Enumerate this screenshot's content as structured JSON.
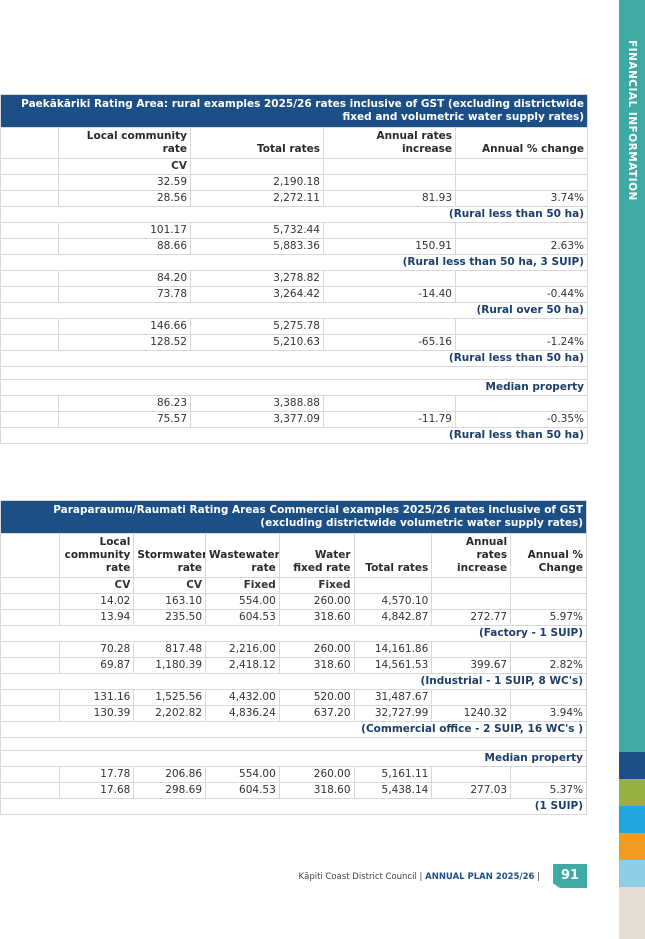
{
  "side": {
    "label": "FINANCIAL INFORMATION"
  },
  "table1": {
    "title": "Paekākāriki Rating Area: rural examples 2025/26 rates inclusive of GST (excluding districtwide fixed and volumetric water supply rates)",
    "headers": [
      "",
      "Local community rate",
      "Total rates",
      "Annual rates increase",
      "Annual % change"
    ],
    "unit_row": [
      "",
      "CV",
      "",
      "",
      ""
    ],
    "groups": [
      {
        "rows": [
          [
            "",
            "32.59",
            "2,190.18",
            "",
            ""
          ],
          [
            "",
            "28.56",
            "2,272.11",
            "81.93",
            "3.74%"
          ]
        ],
        "label": "(Rural less than 50 ha)"
      },
      {
        "rows": [
          [
            "",
            "101.17",
            "5,732.44",
            "",
            ""
          ],
          [
            "",
            "88.66",
            "5,883.36",
            "150.91",
            "2.63%"
          ]
        ],
        "label": "(Rural less than 50 ha, 3 SUIP)"
      },
      {
        "rows": [
          [
            "",
            "84.20",
            "3,278.82",
            "",
            ""
          ],
          [
            "",
            "73.78",
            "3,264.42",
            "-14.40",
            "-0.44%"
          ]
        ],
        "label": "(Rural over 50 ha)"
      },
      {
        "rows": [
          [
            "",
            "146.66",
            "5,275.78",
            "",
            ""
          ],
          [
            "",
            "128.52",
            "5,210.63",
            "-65.16",
            "-1.24%"
          ]
        ],
        "label": "(Rural less than 50 ha)"
      }
    ],
    "median_label": "Median property",
    "median_rows": [
      [
        "",
        "86.23",
        "3,388.88",
        "",
        ""
      ],
      [
        "",
        "75.57",
        "3,377.09",
        "-11.79",
        "-0.35%"
      ]
    ],
    "median_footer": "(Rural less than 50 ha)"
  },
  "table2": {
    "title": "Paraparaumu/Raumati Rating Areas Commercial examples 2025/26 rates inclusive of GST (excluding districtwide volumetric water supply rates)",
    "headers": [
      "",
      "Local community rate",
      "Stormwater rate",
      "Wastewater rate",
      "Water fixed rate",
      "Total rates",
      "Annual rates increase",
      "Annual % Change"
    ],
    "unit_row": [
      "",
      "CV",
      "CV",
      "Fixed",
      "Fixed",
      "",
      "",
      ""
    ],
    "groups": [
      {
        "rows": [
          [
            "",
            "14.02",
            "163.10",
            "554.00",
            "260.00",
            "4,570.10",
            "",
            ""
          ],
          [
            "",
            "13.94",
            "235.50",
            "604.53",
            "318.60",
            "4,842.87",
            "272.77",
            "5.97%"
          ]
        ],
        "label": "(Factory - 1 SUIP)"
      },
      {
        "rows": [
          [
            "",
            "70.28",
            "817.48",
            "2,216.00",
            "260.00",
            "14,161.86",
            "",
            ""
          ],
          [
            "",
            "69.87",
            "1,180.39",
            "2,418.12",
            "318.60",
            "14,561.53",
            "399.67",
            "2.82%"
          ]
        ],
        "label": "(Industrial - 1 SUIP, 8 WC's)"
      },
      {
        "rows": [
          [
            "",
            "131.16",
            "1,525.56",
            "4,432.00",
            "520.00",
            "31,487.67",
            "",
            ""
          ],
          [
            "",
            "130.39",
            "2,202.82",
            "4,836.24",
            "637.20",
            "32,727.99",
            "1240.32",
            "3.94%"
          ]
        ],
        "label": "(Commercial office - 2 SUIP, 16 WC's )"
      }
    ],
    "median_label": "Median property",
    "median_rows": [
      [
        "",
        "17.78",
        "206.86",
        "554.00",
        "260.00",
        "5,161.11",
        "",
        ""
      ],
      [
        "",
        "17.68",
        "298.69",
        "604.53",
        "318.60",
        "5,438.14",
        "277.03",
        "5.37%"
      ]
    ],
    "median_footer": "(1 SUIP)"
  },
  "footer": {
    "council": "Kāpiti Coast District Council",
    "separator": "|",
    "plan": "ANNUAL PLAN 2025/26",
    "page": "91"
  },
  "colors": {
    "header_bg": "#1b4f86",
    "side_bar": "#3fa9a3",
    "blocks": [
      "#1b4f86",
      "#95b23f",
      "#1ea7e1",
      "#f39a21",
      "#8ecde6",
      "#e4ddd3"
    ]
  }
}
